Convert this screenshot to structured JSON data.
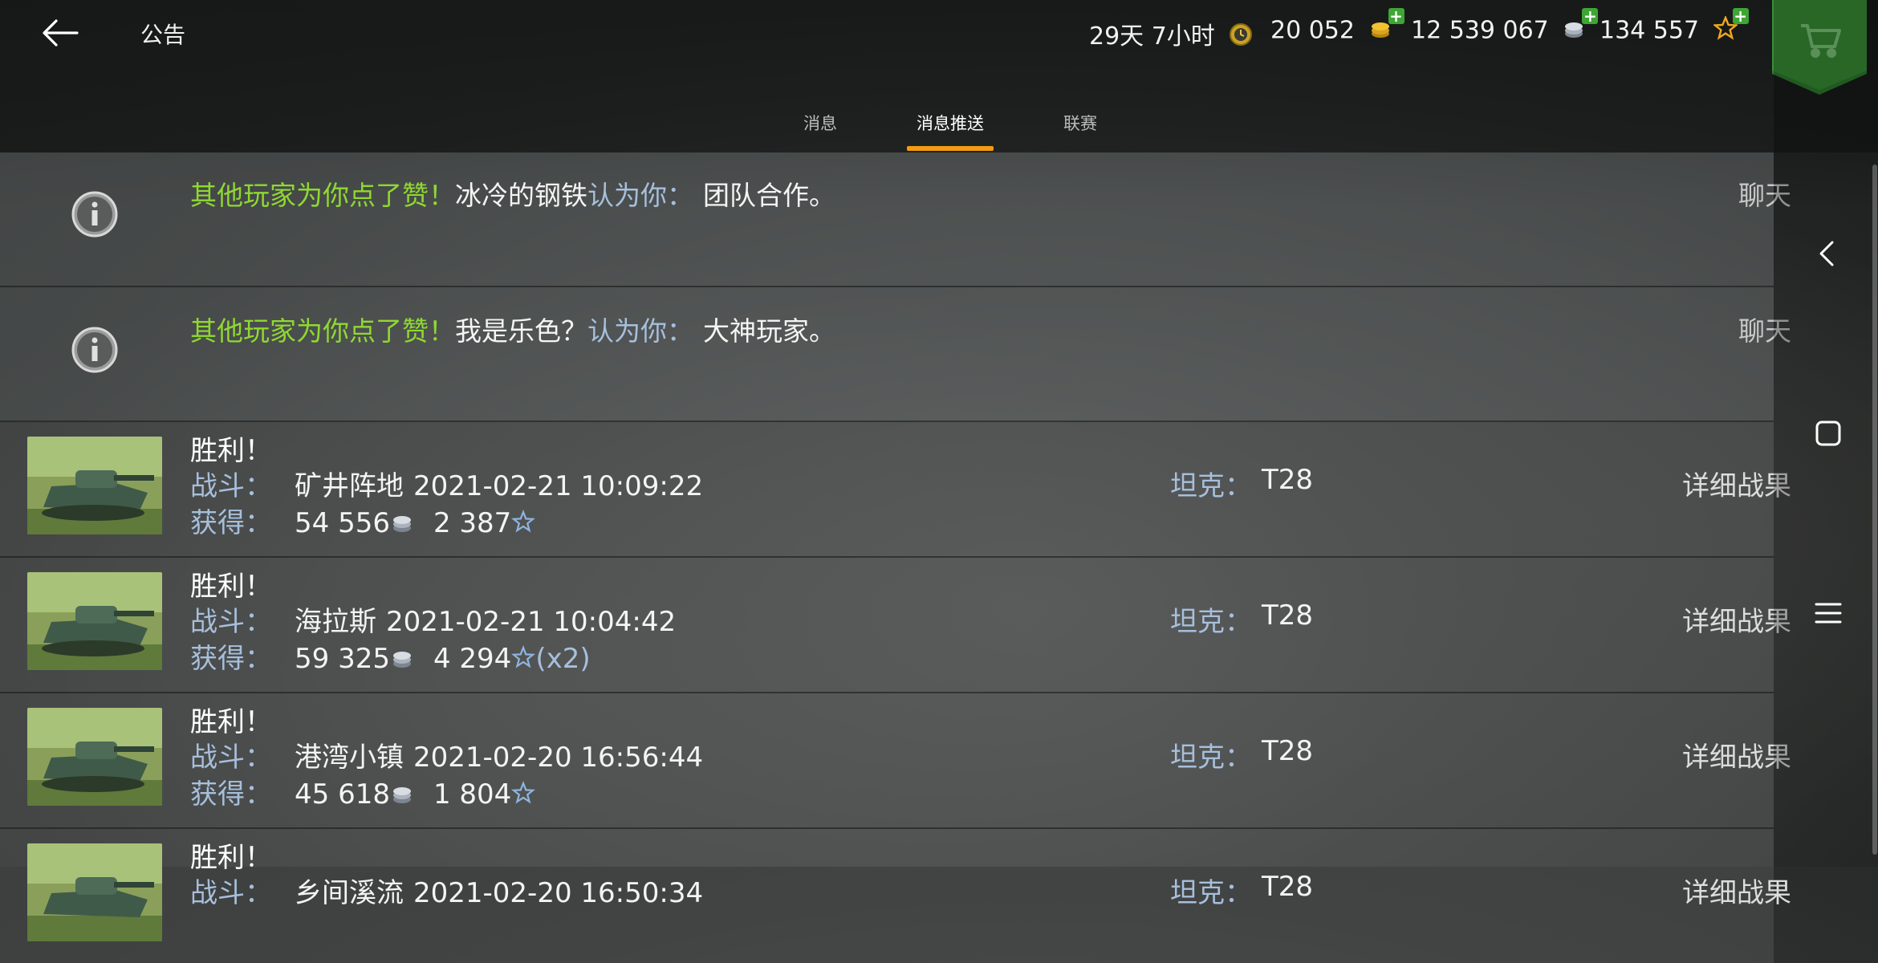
{
  "header": {
    "title": "公告",
    "time_remaining": "29天 7小时",
    "gold": "20 052",
    "credits": "12 539 067",
    "free_xp": "134 557"
  },
  "tabs": [
    {
      "label": "消息",
      "active": false
    },
    {
      "label": "消息推送",
      "active": true
    },
    {
      "label": "联赛",
      "active": false
    }
  ],
  "notifications": [
    {
      "prefix": "其他玩家为你点了赞！",
      "player": "冰冷的钢铁",
      "mid": "认为你：",
      "quality": "团队合作。",
      "action": "聊天"
    },
    {
      "prefix": "其他玩家为你点了赞！",
      "player": "我是乐色？",
      "mid": "认为你：",
      "quality": "大神玩家。",
      "action": "聊天"
    }
  ],
  "battles": [
    {
      "title": "胜利！",
      "battle_label": "战斗：",
      "map": "矿井阵地",
      "datetime": "2021-02-21 10:09:22",
      "earn_label": "获得：",
      "credits": "54 556",
      "xp": "2 387",
      "multiplier": "",
      "tank_label": "坦克：",
      "tank": "T28",
      "details": "详细战果"
    },
    {
      "title": "胜利！",
      "battle_label": "战斗：",
      "map": "海拉斯",
      "datetime": "2021-02-21 10:04:42",
      "earn_label": "获得：",
      "credits": "59 325",
      "xp": "4 294",
      "multiplier": "(x2)",
      "tank_label": "坦克：",
      "tank": "T28",
      "details": "详细战果"
    },
    {
      "title": "胜利！",
      "battle_label": "战斗：",
      "map": "港湾小镇",
      "datetime": "2021-02-20 16:56:44",
      "earn_label": "获得：",
      "credits": "45 618",
      "xp": "1 804",
      "multiplier": "",
      "tank_label": "坦克：",
      "tank": "T28",
      "details": "详细战果"
    },
    {
      "title": "胜利！",
      "battle_label": "战斗：",
      "map": "乡间溪流",
      "datetime": "2021-02-20 16:50:34",
      "earn_label": "获得：",
      "credits": "",
      "xp": "",
      "multiplier": "",
      "tank_label": "坦克：",
      "tank": "T28",
      "details": "详细战果"
    }
  ],
  "icons": {
    "back": "back-arrow-icon",
    "premium": "premium-clock-icon",
    "gold": "gold-coins-icon",
    "credits": "silver-coins-icon",
    "free_xp": "star-icon",
    "store": "shopping-cart-icon",
    "info": "info-icon",
    "system_nav": [
      "nav-back-icon",
      "nav-home-icon",
      "nav-menu-icon"
    ]
  },
  "colors": {
    "accent_tab": "#f39c12",
    "green_text": "#8fd832",
    "label_blue": "#a7bfdc",
    "store_green": "#2f7d2f",
    "plus_green": "#3fa535"
  }
}
